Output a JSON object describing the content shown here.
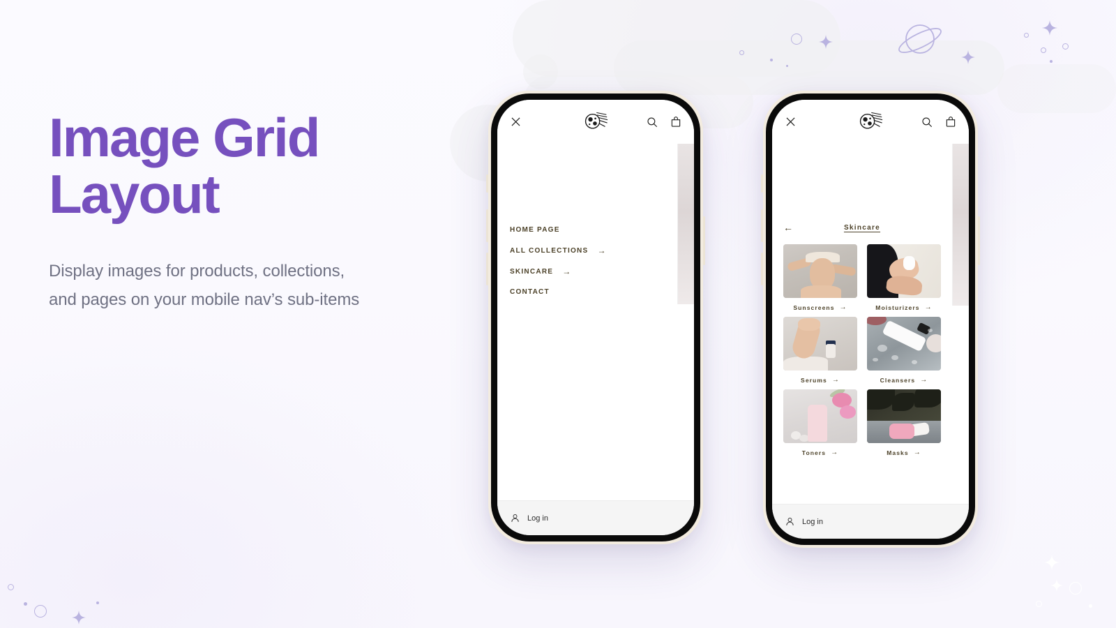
{
  "hero": {
    "title_line1": "Image Grid",
    "title_line2": "Layout",
    "subtitle": "Display images for products, collections, and pages on your mobile nav’s sub-items",
    "accent_color": "#7650be",
    "subtitle_color": "#6f7183"
  },
  "background": {
    "color": "#fbfaff",
    "doodle_color": "#b9b3e0"
  },
  "phone_left": {
    "header": {
      "close_label": "✕",
      "logo_label": "brand-logo",
      "search_label": "search",
      "cart_label": "cart"
    },
    "nav_items": [
      {
        "label": "Home page",
        "has_arrow": false,
        "arrow": "→"
      },
      {
        "label": "All collections",
        "has_arrow": true,
        "arrow": "→"
      },
      {
        "label": "Skincare",
        "has_arrow": true,
        "arrow": "→"
      },
      {
        "label": "Contact",
        "has_arrow": false,
        "arrow": "→"
      }
    ],
    "footer": {
      "login_label": "Log in"
    }
  },
  "phone_right": {
    "header": {
      "close_label": "✕",
      "logo_label": "brand-logo",
      "search_label": "search",
      "cart_label": "cart"
    },
    "grid": {
      "back_arrow": "←",
      "title": "Skincare",
      "tiles": [
        {
          "label": "Sunscreens",
          "arrow": "→",
          "art": "ph-sun"
        },
        {
          "label": "Moisturizers",
          "arrow": "→",
          "art": "ph-moist"
        },
        {
          "label": "Serums",
          "arrow": "→",
          "art": "ph-ser"
        },
        {
          "label": "Cleansers",
          "arrow": "→",
          "art": "ph-cle"
        },
        {
          "label": "Toners",
          "arrow": "→",
          "art": "ph-ton"
        },
        {
          "label": "Masks",
          "arrow": "→",
          "art": "ph-mask"
        }
      ]
    },
    "footer": {
      "login_label": "Log in"
    }
  }
}
